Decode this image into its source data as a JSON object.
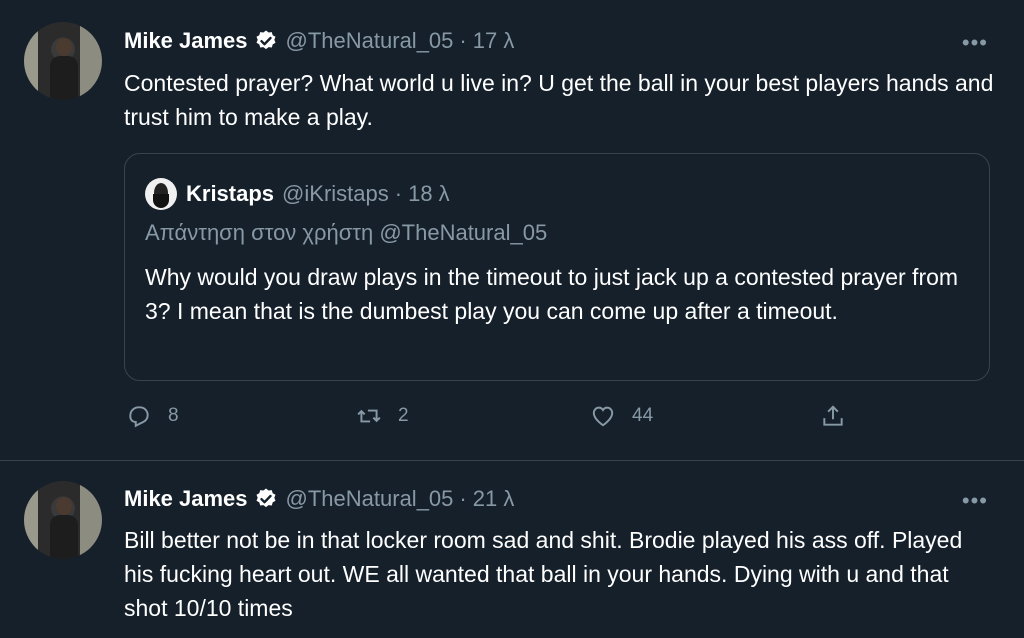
{
  "tweets": [
    {
      "author_name": "Mike James",
      "handle": "@TheNatural_05",
      "separator": "·",
      "time": "17 λ",
      "more": "•••",
      "text": "Contested prayer? What world u live in? U get the ball in your best players hands and trust him to make a play.",
      "quote": {
        "author_name": "Kristaps",
        "handle": "@iKristaps",
        "separator": "·",
        "time": "18 λ",
        "reply_to": "Απάντηση στον χρήστη @TheNatural_05",
        "text": "Why would you draw plays in the timeout to just jack up a contested prayer from 3? I mean that is the dumbest play you can come up after a timeout."
      },
      "actions": {
        "reply_count": "8",
        "retweet_count": "2",
        "like_count": "44"
      }
    },
    {
      "author_name": "Mike James",
      "handle": "@TheNatural_05",
      "separator": "·",
      "time": "21 λ",
      "more": "•••",
      "text": "Bill better not be in that locker room sad and shit. Brodie played his ass off. Played his fucking heart out. WE all wanted that ball in your hands. Dying with u and that shot 10/10 times"
    }
  ],
  "icons": {
    "verified": "verified-badge-icon",
    "reply": "reply-icon",
    "retweet": "retweet-icon",
    "like": "heart-icon",
    "share": "share-icon",
    "more": "more-icon"
  },
  "colors": {
    "background": "#15202b",
    "muted": "#8899a6",
    "border": "#38444d",
    "text": "#ffffff"
  }
}
